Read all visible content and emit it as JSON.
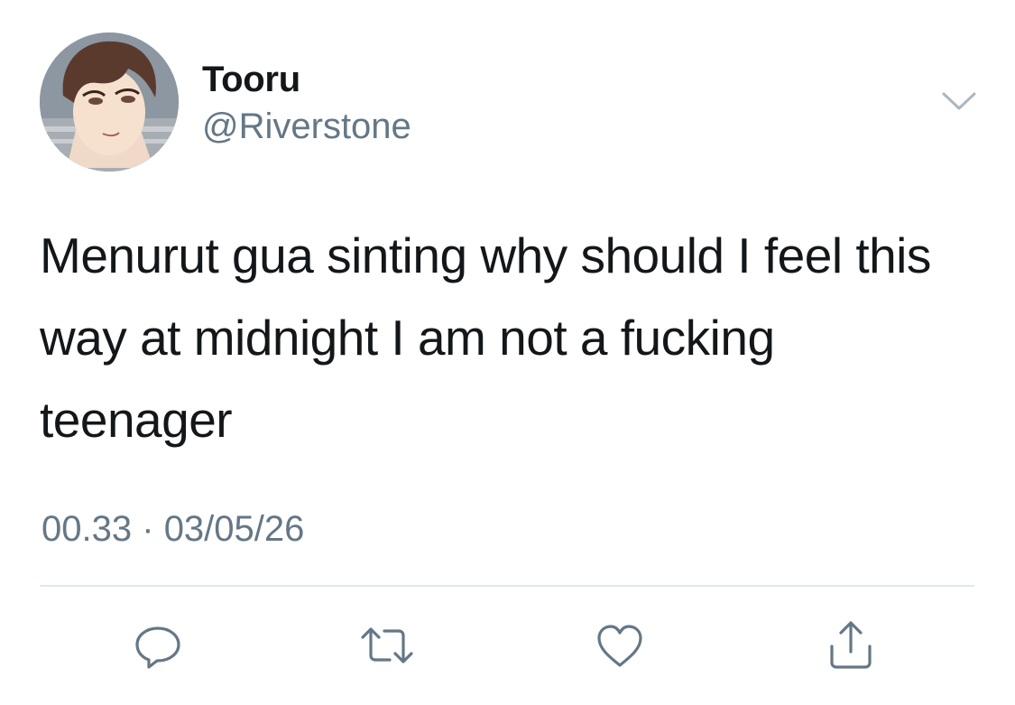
{
  "author": {
    "display_name": "Tooru",
    "handle": "@Riverstone"
  },
  "tweet": {
    "text": "Menurut gua sinting why should I feel this way at midnight I am not a fucking teenager",
    "time": "00.33",
    "separator": "·",
    "date": "03/05/26"
  },
  "actions": {
    "reply_icon": "reply-icon",
    "retweet_icon": "retweet-icon",
    "like_icon": "heart-icon",
    "share_icon": "share-icon"
  },
  "colors": {
    "text": "#14171a",
    "secondary": "#657786",
    "divider": "#e1e8ed",
    "icon": "#657786"
  }
}
